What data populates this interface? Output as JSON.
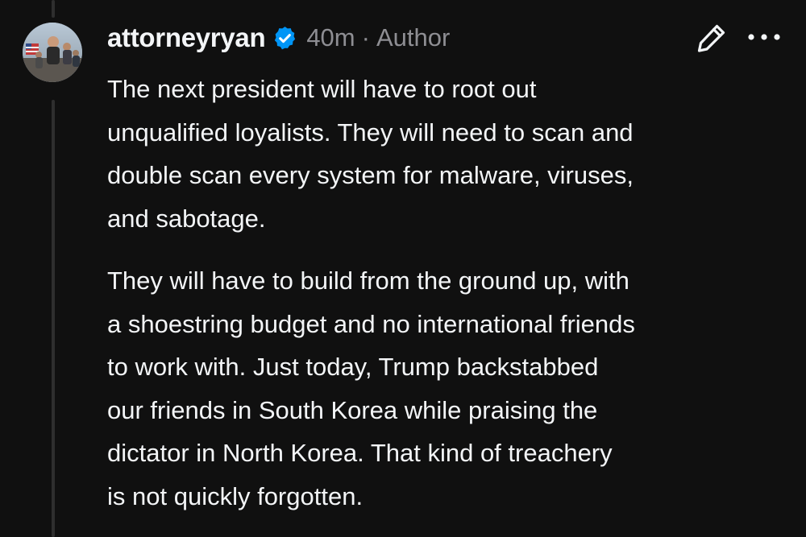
{
  "author": {
    "username": "attorneyryan",
    "timestamp": "40m",
    "separator": "·",
    "role_badge": "Author",
    "verified_icon": "verified-badge-icon",
    "avatar_icon": "avatar-photo"
  },
  "actions": {
    "edit_icon": "pencil-icon",
    "more_icon": "more-options-icon"
  },
  "post": {
    "paragraph_1": [
      "The next president will have to root out",
      "unqualified loyalists. They will need to scan and",
      "double scan every system for malware, viruses,",
      "and sabotage."
    ],
    "paragraph_2": [
      "They will have to build from the ground up, with",
      "a shoestring budget and no international friends",
      "to work with. Just today, Trump backstabbed",
      "our friends in South Korea while praising the",
      "dictator in North Korea. That kind of treachery",
      "is not quickly forgotten."
    ]
  },
  "colors": {
    "background": "#101010",
    "text_primary": "#f3f5f7",
    "text_secondary": "#8e8e93",
    "verified_blue": "#0095f6",
    "thread_line": "#2e2e2e"
  }
}
